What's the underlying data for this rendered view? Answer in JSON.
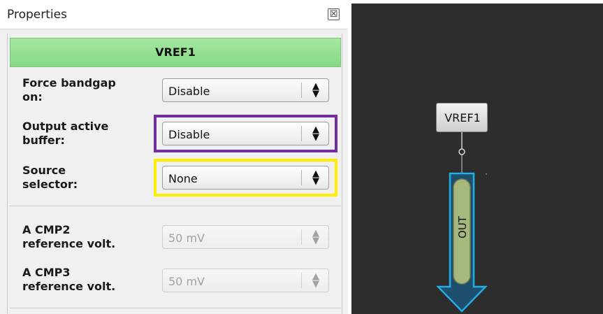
{
  "panel": {
    "title": "Properties",
    "close_glyph": "☒",
    "component_name": "VREF1",
    "header_color": "#8fdc8b",
    "fields": [
      {
        "label_lines": [
          "Force bandgap",
          "on:"
        ],
        "value": "Disable",
        "enabled": true
      },
      {
        "label_lines": [
          "Output active",
          "buffer:"
        ],
        "value": "Disable",
        "enabled": true,
        "highlight": "#7030a0"
      },
      {
        "label_lines": [
          "Source",
          "selector:"
        ],
        "value": "None",
        "enabled": true,
        "highlight": "#ffee00"
      },
      {
        "label_lines": [
          "A CMP2",
          "reference volt."
        ],
        "value": "50 mV",
        "enabled": false
      },
      {
        "label_lines": [
          "A CMP3",
          "reference volt."
        ],
        "value": "50 mV",
        "enabled": false
      }
    ],
    "select_arrow_glyph": "▲▼"
  },
  "canvas": {
    "background": "#2d2d2d",
    "node_label": "VREF1",
    "pin_label": "OUT",
    "pin_outline_color": "#1ea4e0",
    "pin_fill_color": "#a7b87c"
  }
}
